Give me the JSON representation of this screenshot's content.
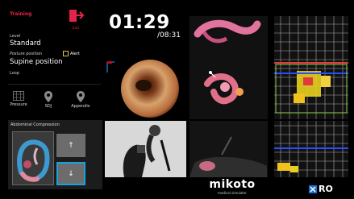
{
  "header": {
    "mode_label": "Training",
    "exit_label": "Exit",
    "timer_main": "01:29",
    "timer_total": "/08:31"
  },
  "settings": {
    "level_label": "Level",
    "level_value": "Standard",
    "posture_label": "Posture position",
    "alert_label": "Alert",
    "posture_value": "Supine position",
    "loop_label": "Loop"
  },
  "tools": [
    {
      "label": "Pressure",
      "icon": "grid-icon"
    },
    {
      "label": "SDJ",
      "icon": "location-pin-icon"
    },
    {
      "label": "Appendix",
      "icon": "location-pin-icon"
    }
  ],
  "abdominal": {
    "title": "Abdominal Compression",
    "up_label": "↑",
    "down_label": "↓"
  },
  "branding": {
    "brand": "mikoto",
    "brand_sub": "medical simulator",
    "logo_text": "RO"
  },
  "colors": {
    "accent_red": "#e32348",
    "accent_blue": "#1a6fd6",
    "grid_green": "#6fbf4a"
  }
}
